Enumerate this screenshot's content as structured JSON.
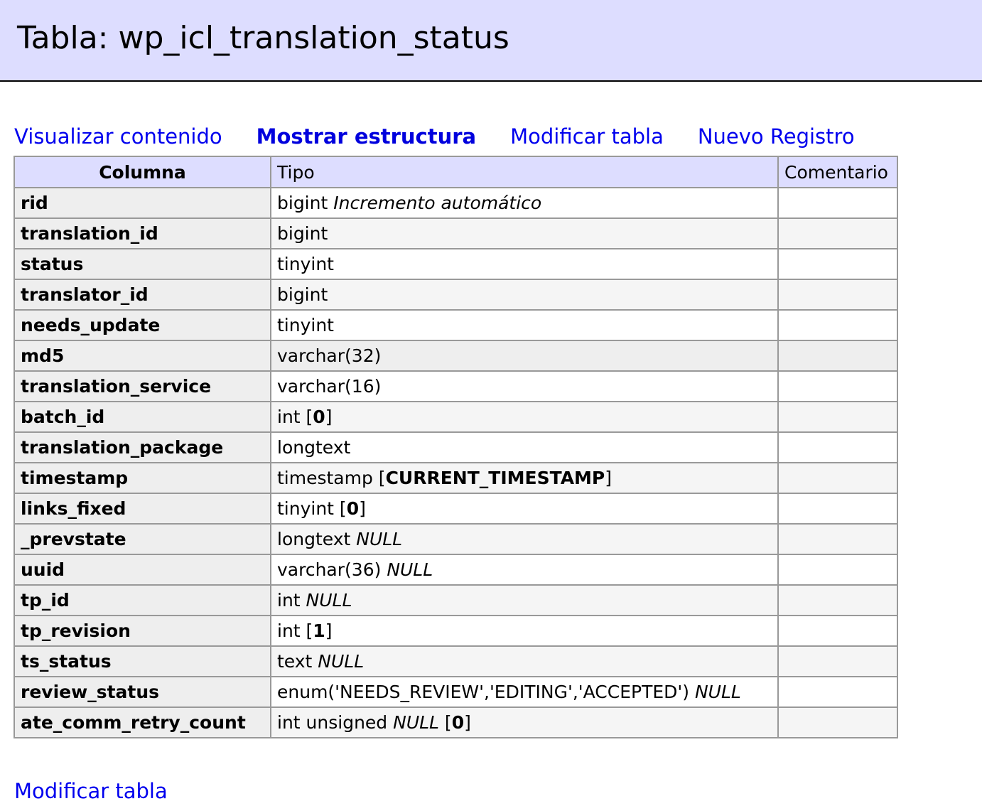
{
  "header": {
    "title": "Tabla: wp_icl_translation_status"
  },
  "links": [
    {
      "label": "Visualizar contenido",
      "active": false
    },
    {
      "label": "Mostrar estructura",
      "active": true
    },
    {
      "label": "Modificar tabla",
      "active": false
    },
    {
      "label": "Nuevo Registro",
      "active": false
    }
  ],
  "table": {
    "headers": {
      "column": "Columna",
      "type": "Tipo",
      "comment": "Comentario"
    },
    "rows": [
      {
        "name": "rid",
        "type": "bigint",
        "auto": "Incremento automático",
        "comment": ""
      },
      {
        "name": "translation_id",
        "type": "bigint",
        "comment": ""
      },
      {
        "name": "status",
        "type": "tinyint",
        "comment": ""
      },
      {
        "name": "translator_id",
        "type": "bigint",
        "comment": ""
      },
      {
        "name": "needs_update",
        "type": "tinyint",
        "comment": ""
      },
      {
        "name": "md5",
        "type": "varchar(32)",
        "comment": ""
      },
      {
        "name": "translation_service",
        "type": "varchar(16)",
        "comment": ""
      },
      {
        "name": "batch_id",
        "type": "int",
        "default": "0",
        "comment": ""
      },
      {
        "name": "translation_package",
        "type": "longtext",
        "comment": ""
      },
      {
        "name": "timestamp",
        "type": "timestamp",
        "default": "CURRENT_TIMESTAMP",
        "comment": ""
      },
      {
        "name": "links_fixed",
        "type": "tinyint",
        "default": "0",
        "comment": ""
      },
      {
        "name": "_prevstate",
        "type": "longtext",
        "null": "NULL",
        "comment": ""
      },
      {
        "name": "uuid",
        "type": "varchar(36)",
        "null": "NULL",
        "comment": ""
      },
      {
        "name": "tp_id",
        "type": "int",
        "null": "NULL",
        "comment": ""
      },
      {
        "name": "tp_revision",
        "type": "int",
        "default": "1",
        "comment": ""
      },
      {
        "name": "ts_status",
        "type": "text",
        "null": "NULL",
        "comment": ""
      },
      {
        "name": "review_status",
        "type": "enum('NEEDS_REVIEW','EDITING','ACCEPTED')",
        "null": "NULL",
        "comment": ""
      },
      {
        "name": "ate_comm_retry_count",
        "type": "int unsigned",
        "null": "NULL",
        "default": "0",
        "comment": ""
      }
    ]
  },
  "footer": {
    "link_label": "Modificar tabla"
  }
}
